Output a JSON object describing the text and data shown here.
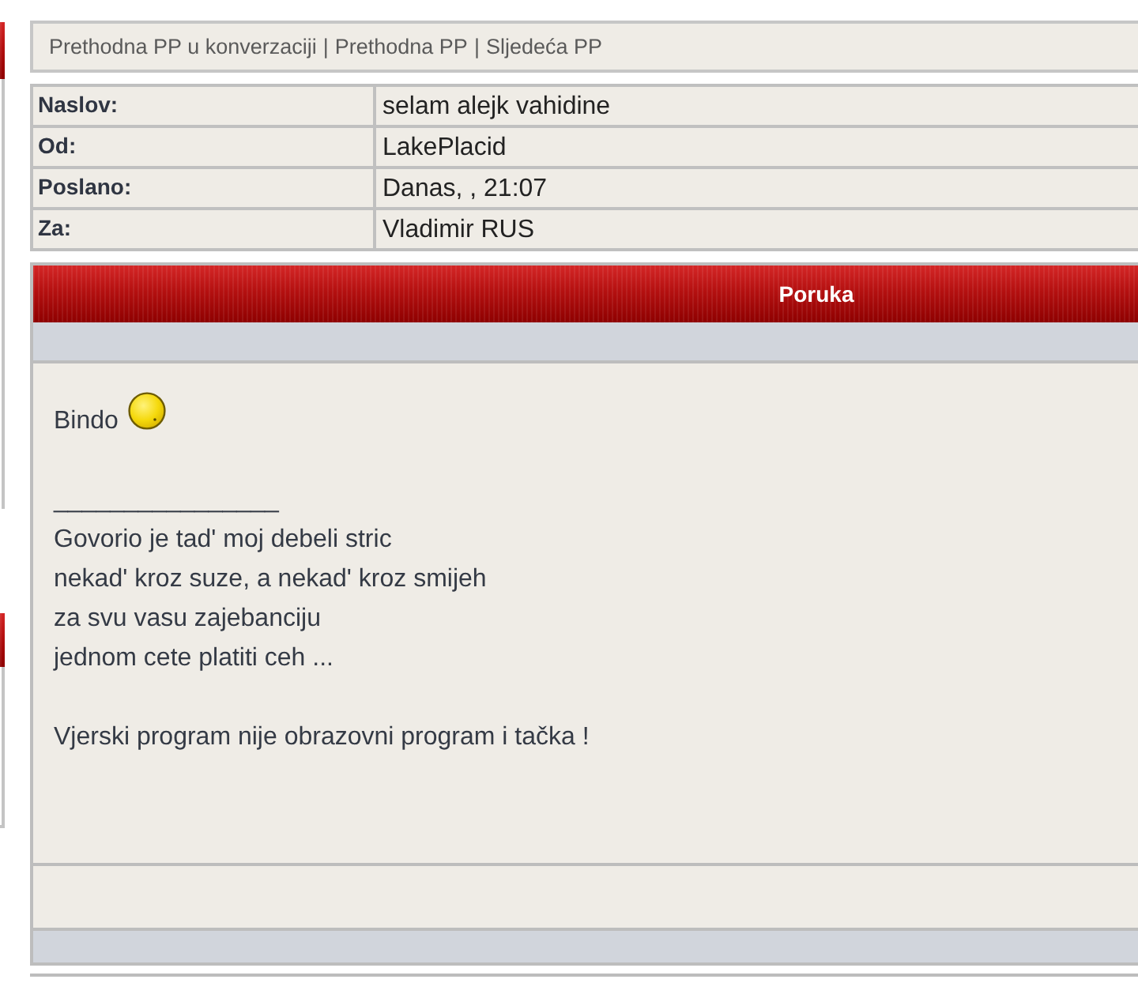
{
  "nav": {
    "separator": "|",
    "links": [
      {
        "label": "Prethodna PP u konverzaciji"
      },
      {
        "label": "Prethodna PP"
      },
      {
        "label": "Sljedeća PP"
      }
    ]
  },
  "details": [
    {
      "label": "Naslov:",
      "value": "selam alejk vahidine"
    },
    {
      "label": "Od:",
      "value": "LakePlacid"
    },
    {
      "label": "Poslano:",
      "value": "Danas, , 21:07"
    },
    {
      "label": "Za:",
      "value": "Vladimir RUS"
    }
  ],
  "message": {
    "title": "Poruka",
    "lines": [
      {
        "kind": "text_with_emoticon",
        "text": "Bindo"
      },
      {
        "kind": "blank"
      },
      {
        "kind": "text",
        "text": "________________"
      },
      {
        "kind": "text",
        "text": "Govorio je tad' moj debeli stric"
      },
      {
        "kind": "text",
        "text": "nekad' kroz suze, a nekad' kroz smijeh"
      },
      {
        "kind": "text",
        "text": "za svu vasu zajebanciju"
      },
      {
        "kind": "text",
        "text": "jednom cete platiti ceh ..."
      },
      {
        "kind": "blank"
      },
      {
        "kind": "text",
        "text": "Vjerski program nije obrazovni program i tačka !"
      }
    ]
  }
}
